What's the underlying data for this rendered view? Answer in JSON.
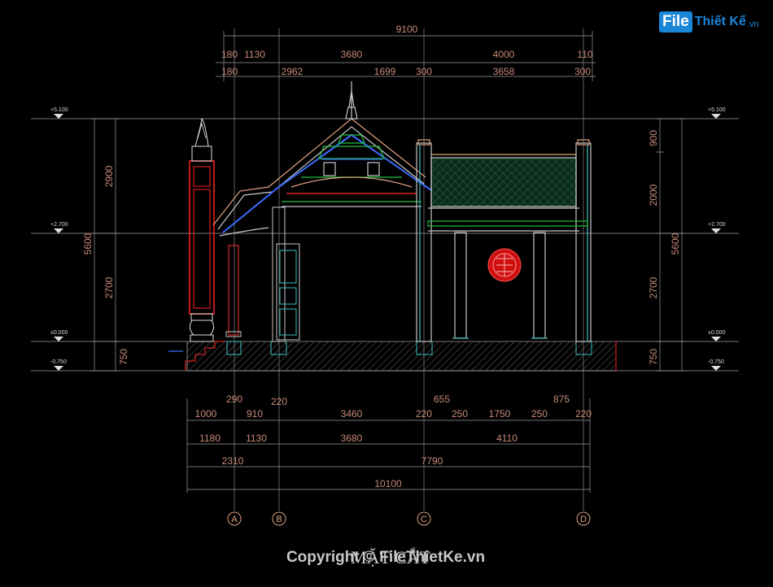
{
  "logo": {
    "brand": "File",
    "name": "Thiết Kế",
    "tld": ".vn"
  },
  "title": "MẶT CẮT",
  "copyright": "Copyright © FileThietKe.vn",
  "top_dims": {
    "overall": "9100",
    "row1": [
      "180",
      "1130",
      "3680",
      "4000",
      "110"
    ],
    "row2": [
      "180",
      "2962",
      "1699",
      "300",
      "3658",
      "300"
    ]
  },
  "bottom_dims": {
    "row0": [
      "290",
      "220",
      "655",
      "875"
    ],
    "row1": [
      "1000",
      "910",
      "3460",
      "220",
      "250",
      "1750",
      "250",
      "220"
    ],
    "row2": [
      "1180",
      "1130",
      "3680",
      "4110"
    ],
    "row3": [
      "2310",
      "7790"
    ],
    "row4": "10100"
  },
  "left_dims": {
    "total": "5600",
    "upper": "2900",
    "lower": "2700",
    "base": "750"
  },
  "right_dims": {
    "total": "5600",
    "top": "900",
    "upper": "2000",
    "lower": "2700",
    "base": "750"
  },
  "levels": [
    "+5.100",
    "+2.700",
    "±0.000",
    "-0.750"
  ],
  "grid_axes": [
    "A",
    "B",
    "C",
    "D"
  ]
}
